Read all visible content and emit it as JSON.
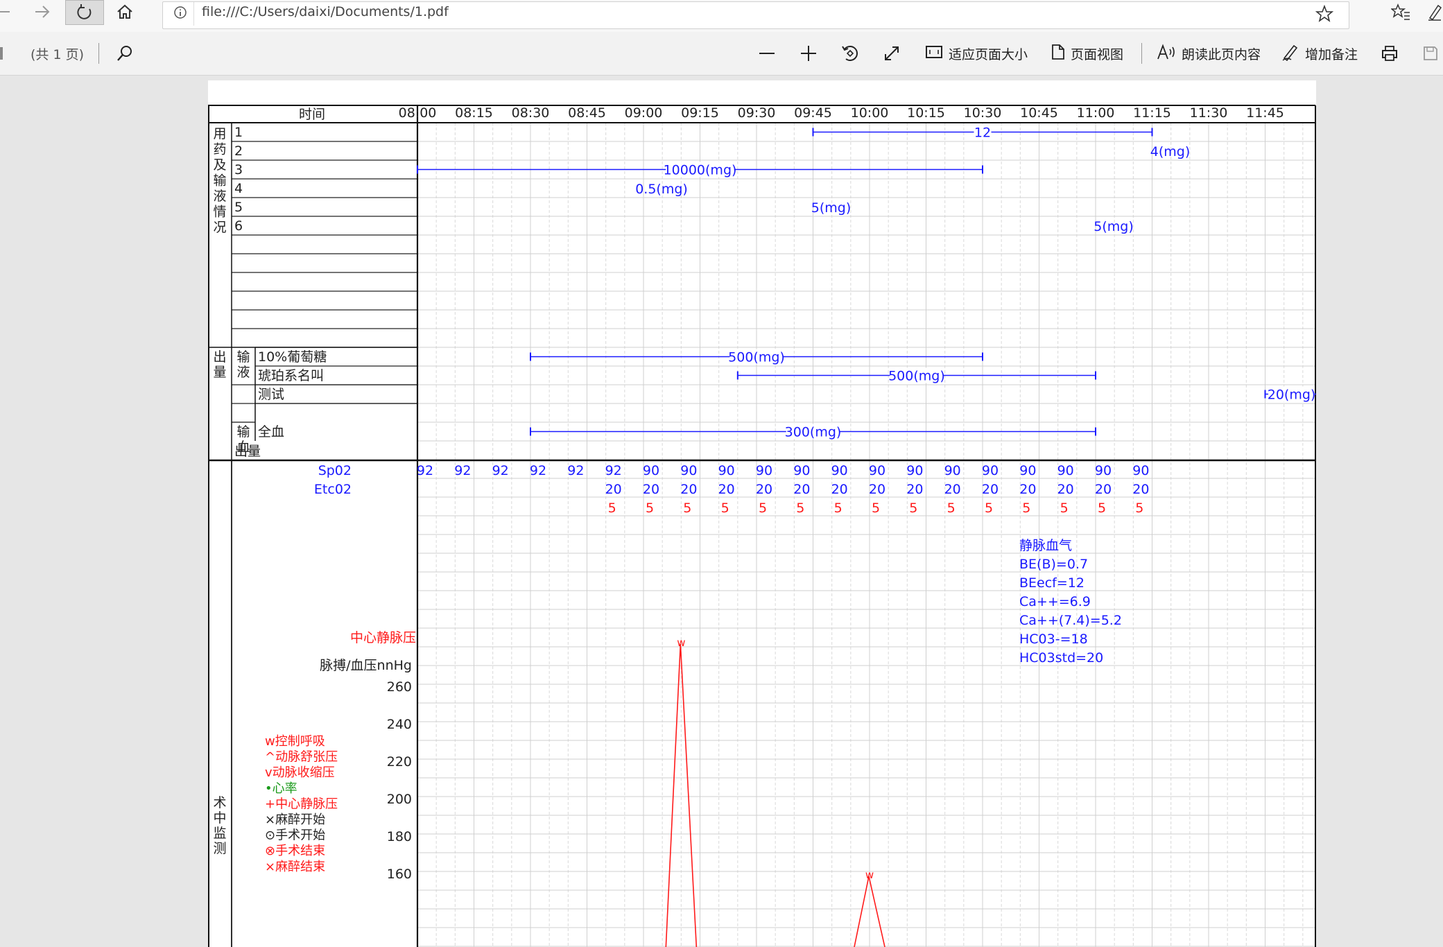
{
  "browser": {
    "url": "file:///C:/Users/daixi/Documents/1.pdf",
    "icons": [
      "back-arrow-icon",
      "forward-arrow-icon",
      "refresh-icon",
      "home-icon",
      "info-icon",
      "star-icon",
      "favorites-icon",
      "pen-icon"
    ]
  },
  "pdf_toolbar": {
    "page_count": "(共 1 页)",
    "fit_page": "适应页面大小",
    "page_view": "页面视图",
    "read_aloud": "朗读此页内容",
    "add_note": "增加备注",
    "icons": [
      "search-icon",
      "zoom-out-icon",
      "zoom-in-icon",
      "rotate-icon",
      "fullscreen-icon",
      "fit-page-icon",
      "page-view-icon",
      "read-aloud-icon",
      "add-note-icon",
      "print-icon",
      "save-icon"
    ]
  },
  "record": {
    "time_header": "时间",
    "times": [
      "08:00",
      "08:15",
      "08:30",
      "08:45",
      "09:00",
      "09:15",
      "09:30",
      "09:45",
      "10:00",
      "10:15",
      "10:30",
      "10:45",
      "11:00",
      "11:15",
      "11:30",
      "11:45"
    ],
    "meds_section_label": [
      "用",
      "药",
      "及",
      "输",
      "液",
      "情",
      "况"
    ],
    "med_rows": [
      "1",
      "2",
      "3",
      "4",
      "5",
      "6",
      "",
      "",
      "",
      "",
      "",
      ""
    ],
    "output_section_label": [
      "出",
      "量"
    ],
    "infusion_label": [
      "输",
      "液"
    ],
    "infusion_rows": [
      "10%葡萄糖",
      "琥珀系名叫",
      "测试",
      "",
      "",
      ""
    ],
    "transfusion_label": [
      "输",
      "血"
    ],
    "transfusion_rows": [
      "全血",
      ""
    ],
    "output_row": "出量",
    "med_marks": [
      {
        "row": "1",
        "label": "12",
        "start": "09:45",
        "end": "11:15",
        "kind": "bar",
        "color": "#1a1aff"
      },
      {
        "row": "2",
        "label": "4(mg)",
        "at": "11:15",
        "kind": "text",
        "color": "#1a1aff"
      },
      {
        "row": "3",
        "label": "10000(mg)",
        "start": "08:00",
        "end": "10:30",
        "kind": "bar",
        "color": "#1a1aff"
      },
      {
        "row": "4",
        "label": "0.5(mg)",
        "at": "09:00",
        "kind": "text",
        "color": "#1a1aff"
      },
      {
        "row": "5",
        "label": "5(mg)",
        "at": "09:45",
        "kind": "text",
        "color": "#1a1aff"
      },
      {
        "row": "6",
        "label": "5(mg)",
        "at": "11:00",
        "kind": "text",
        "color": "#1a1aff"
      }
    ],
    "infusion_marks": [
      {
        "row": "10%葡萄糖",
        "label": "500(mg)",
        "start": "08:30",
        "end": "10:30"
      },
      {
        "row": "琥珀系名叫",
        "label": "500(mg)",
        "start": "09:25",
        "end": "11:00"
      },
      {
        "row": "测试",
        "label": "20(mg)",
        "start": "11:45",
        "end": "11:59"
      }
    ],
    "transfusion_marks": [
      {
        "row": "全血",
        "label": "300(mg)",
        "start": "08:30",
        "end": "11:00"
      }
    ],
    "monitor_section_label": [
      "术",
      "中",
      "监",
      "测"
    ],
    "spo2_label": "Sp02",
    "etco2_label": "Etc02",
    "spo2_values": [
      "92",
      "92",
      "92",
      "92",
      "92",
      "92",
      "90",
      "90",
      "90",
      "90",
      "90",
      "90",
      "90",
      "90",
      "90",
      "90",
      "90",
      "90",
      "90",
      "90"
    ],
    "etco2_values": [
      "",
      "",
      "",
      "",
      "",
      "20",
      "20",
      "20",
      "20",
      "20",
      "20",
      "20",
      "20",
      "20",
      "20",
      "20",
      "20",
      "20",
      "20",
      "20"
    ],
    "red_values": [
      "",
      "",
      "",
      "",
      "",
      "5",
      "5",
      "5",
      "5",
      "5",
      "5",
      "5",
      "5",
      "5",
      "5",
      "5",
      "5",
      "5",
      "5",
      "5"
    ],
    "blood_gas_title": "静脉血气",
    "blood_gas_lines": [
      "BE(B)=0.7",
      "BEecf=12",
      "Ca++=6.9",
      "Ca++(7.4)=5.2",
      "HC03-=18",
      "HC03std=20"
    ],
    "cvp_label": "中心静脉压",
    "pulse_bp_label": "脉搏/血压nnHg",
    "y_ticks": [
      "260",
      "240",
      "220",
      "200",
      "180",
      "160"
    ],
    "legend": [
      {
        "symbol": "w",
        "text": "控制呼吸",
        "color": "#ff1a1a"
      },
      {
        "symbol": "^",
        "text": "动脉舒张压",
        "color": "#ff1a1a"
      },
      {
        "symbol": "v",
        "text": "动脉收缩压",
        "color": "#ff1a1a"
      },
      {
        "symbol": "•",
        "text": "心率",
        "color": "#1a9a1a"
      },
      {
        "symbol": "+",
        "text": "中心静脉压",
        "color": "#ff1a1a"
      },
      {
        "symbol": "×",
        "text": "麻醉开始",
        "color": "#222222"
      },
      {
        "symbol": "⊙",
        "text": "手术开始",
        "color": "#222222"
      },
      {
        "symbol": "⊗",
        "text": "手术结束",
        "color": "#ff1a1a"
      },
      {
        "symbol": "×",
        "text": "麻醉结束",
        "color": "#ff1a1a"
      }
    ],
    "colors": {
      "blue": "#1a1aff",
      "red": "#ff1a1a",
      "grid": "#cfcfcf",
      "grid_dash": "#d9d9d9"
    }
  }
}
